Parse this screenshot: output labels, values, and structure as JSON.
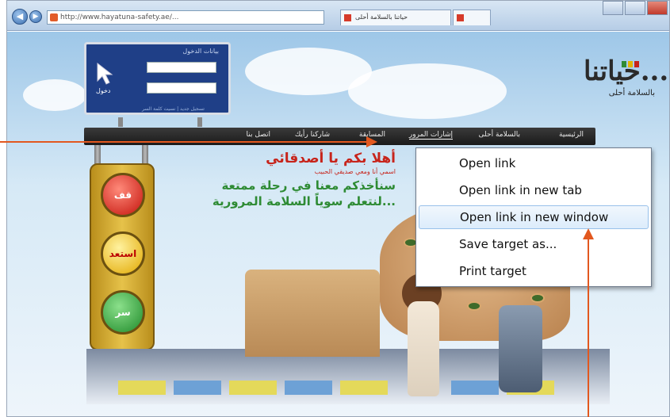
{
  "browser": {
    "address_url": "http://www.hayatuna-safety.ae/...",
    "tabs": [
      {
        "label": "حياتنا بالسلامة أحلى"
      },
      {
        "label": ""
      }
    ]
  },
  "site": {
    "logo_title": "حياتنا...",
    "logo_subtitle": "بالسلامة أحلى",
    "login": {
      "title": "بيانات الدخول",
      "submit_label": "دخول",
      "links": "تسجيل جديد | نسيت كلمة السر"
    },
    "menu": [
      {
        "label": "الرئيسية"
      },
      {
        "label": "بالسلامة أحلى"
      },
      {
        "label": "إشارات المرور"
      },
      {
        "label": "المسابقة"
      },
      {
        "label": "شاركنا رأيك"
      },
      {
        "label": "اتصل بنا"
      }
    ],
    "welcome": {
      "line1": "أهلا بكم يا أصدقائي",
      "line2": "اسمي أنا ومعي صديقي الحبيب",
      "line3": "سنأخذكم معنا في رحلة ممتعة",
      "line4": "لنتعلم سوياً السلامة المرورية..."
    },
    "traffic_light": {
      "red": "قف",
      "yellow": "استعد",
      "green": "سر"
    }
  },
  "context_menu": {
    "items": [
      {
        "label": "Open link"
      },
      {
        "label": "Open link in new tab"
      },
      {
        "label": "Open link in new window"
      },
      {
        "label": "Save target as..."
      },
      {
        "label": "Print target"
      }
    ],
    "highlighted_index": 2
  },
  "colors": {
    "annotation_arrow": "#e2581f",
    "menu_hover_border": "#98c1ea"
  }
}
